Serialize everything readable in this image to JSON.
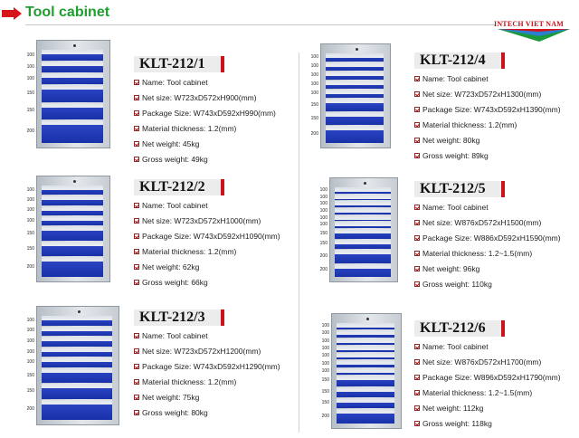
{
  "header": {
    "title": "Tool cabinet"
  },
  "logo": {
    "brand": "INTECH VIET NAM"
  },
  "colors": {
    "accent_red": "#c9141c",
    "title_green": "#1f9e2f",
    "drawer_blue": "#1f38b5"
  },
  "products": [
    {
      "model": "KLT-212/1",
      "name": "Name: Tool cabinet",
      "net_size": "Net size: W723xD572xH900(mm)",
      "package_size": "Package Size: W743xD592xH990(mm)",
      "material": "Material thickness: 1.2(mm)",
      "net_weight": "Net weight: 45kg",
      "gross_weight": "Gross weight: 49kg",
      "drawer_labels": [
        "100",
        "100",
        "100",
        "150",
        "150",
        "200"
      ]
    },
    {
      "model": "KLT-212/2",
      "name": "Name: Tool cabinet",
      "net_size": "Net size: W723xD572xH1000(mm)",
      "package_size": "Package Size: W743xD592xH1090(mm)",
      "material": "Material thickness: 1.2(mm)",
      "net_weight": "Net weight: 62kg",
      "gross_weight": "Gross weight: 66kg",
      "drawer_labels": [
        "100",
        "100",
        "100",
        "100",
        "150",
        "150",
        "200"
      ]
    },
    {
      "model": "KLT-212/3",
      "name": "Name: Tool cabinet",
      "net_size": "Net size: W723xD572xH1200(mm)",
      "package_size": "Package Size: W743xD592xH1290(mm)",
      "material": "Material thickness: 1.2(mm)",
      "net_weight": "Net weight: 75kg",
      "gross_weight": "Gross weight: 80kg",
      "drawer_labels": [
        "100",
        "100",
        "100",
        "100",
        "100",
        "150",
        "150",
        "200"
      ]
    },
    {
      "model": "KLT-212/4",
      "name": "Name: Tool cabinet",
      "net_size": "Net size: W723xD572xH1300(mm)",
      "package_size": "Package Size: W743xD592xH1390(mm)",
      "material": "Material thickness: 1.2(mm)",
      "net_weight": "Net weight: 80kg",
      "gross_weight": "Gross weight: 89kg",
      "drawer_labels": [
        "100",
        "100",
        "100",
        "100",
        "100",
        "150",
        "150",
        "200"
      ]
    },
    {
      "model": "KLT-212/5",
      "name": "Name: Tool cabinet",
      "net_size": "Net size: W876xD572xH1500(mm)",
      "package_size": "Package Size: W886xD592xH1590(mm)",
      "material": "Material thickness: 1.2~1.5(mm)",
      "net_weight": "Net weight: 96kg",
      "gross_weight": "Gross weight: 110kg",
      "drawer_labels": [
        "100",
        "100",
        "100",
        "100",
        "100",
        "100",
        "150",
        "150",
        "200",
        "200"
      ]
    },
    {
      "model": "KLT-212/6",
      "name": "Name: Tool cabinet",
      "net_size": "Net size: W876xD572xH1700(mm)",
      "package_size": "Package Size: W896xD592xH1790(mm)",
      "material": "Material thickness: 1.2~1.5(mm)",
      "net_weight": "Net weight: 112kg",
      "gross_weight": "Gross weight: 118kg",
      "drawer_labels": [
        "100",
        "100",
        "100",
        "100",
        "100",
        "100",
        "100",
        "150",
        "150",
        "150",
        "200"
      ]
    }
  ]
}
